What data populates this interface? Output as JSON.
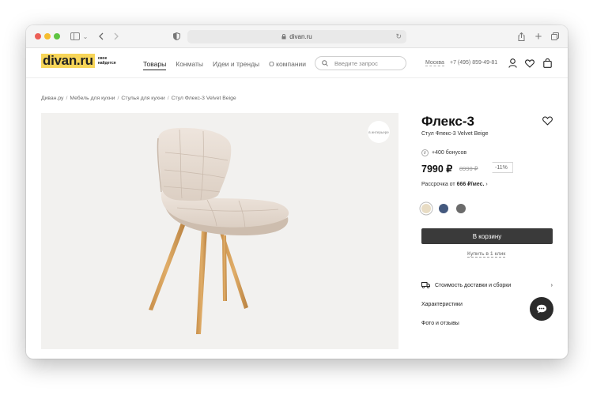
{
  "browser": {
    "url": "divan.ru",
    "colors": {
      "close": "#ec5f57",
      "minimize": "#f5bd2f",
      "zoom": "#5ec442"
    }
  },
  "header": {
    "logo": "divan.ru",
    "logo_tagline": "свое найдется",
    "nav": [
      "Товары",
      "Конматы",
      "Идеи и тренды",
      "О компании"
    ],
    "search_placeholder": "Введите запрос",
    "city": "Москва",
    "phone": "+7 (495) 859-49-81"
  },
  "breadcrumb": [
    "Диван.ру",
    "Мебель для кухни",
    "Стулья для кухни",
    "Стул Флекс-3 Velvet Beige"
  ],
  "gallery": {
    "badge": "в интерьере"
  },
  "product": {
    "title": "Флекс-3",
    "subtitle": "Стул Флекс-3 Velvet Beige",
    "bonus": "+400 бонусов",
    "price": "7990 ₽",
    "old_price": "8990 ₽",
    "discount": "-11%",
    "installment_prefix": "Рассрочка от",
    "installment_amount": "666 ₽/мес.",
    "colors": [
      "#e8dcc4",
      "#44597e",
      "#6b6b6b"
    ],
    "add_to_cart": "В корзину",
    "one_click": "Купить в 1 клик"
  },
  "accordion": [
    "Стоимость доставки и сборки",
    "Характеристики",
    "Фото и отзывы"
  ]
}
